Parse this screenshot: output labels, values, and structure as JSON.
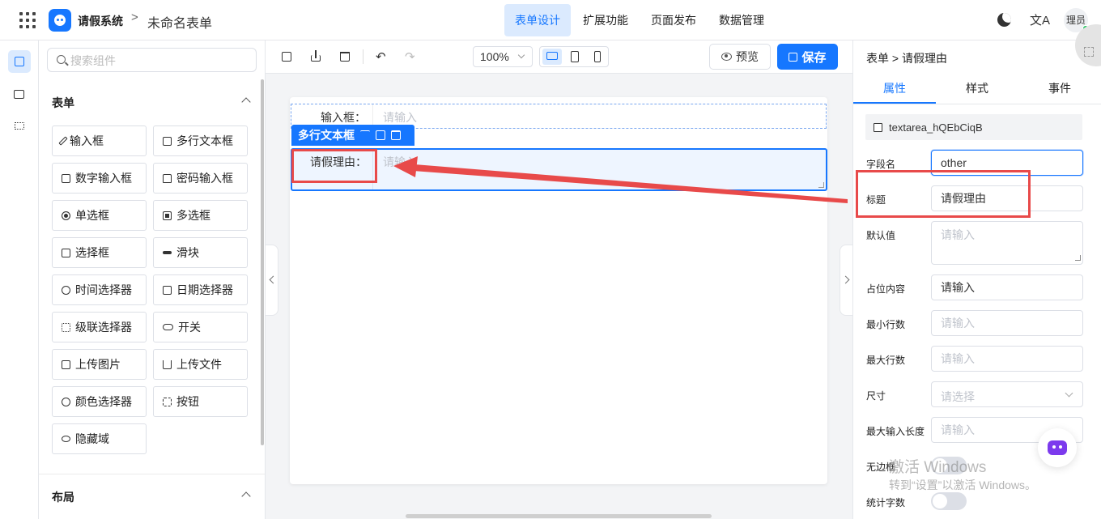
{
  "header": {
    "app_name": "请假系统",
    "separator": ">",
    "doc_name": "未命名表单",
    "tabs": [
      {
        "label": "表单设计",
        "active": true
      },
      {
        "label": "扩展功能",
        "active": false
      },
      {
        "label": "页面发布",
        "active": false
      },
      {
        "label": "数据管理",
        "active": false
      }
    ],
    "lang_glyph": "文A",
    "avatar_text": "理员",
    "accent_color": "#1677ff"
  },
  "rail": {
    "items": [
      {
        "icon": "puzzle-icon",
        "active": true
      },
      {
        "icon": "code-block-icon",
        "active": false
      },
      {
        "icon": "tree-icon",
        "active": false
      }
    ]
  },
  "components": {
    "search_placeholder": "搜索组件",
    "sections": [
      {
        "title": "表单",
        "items": [
          {
            "label": "输入框",
            "icon": "pen-icon"
          },
          {
            "label": "多行文本框",
            "icon": "textarea-icon"
          },
          {
            "label": "数字输入框",
            "icon": "number-icon"
          },
          {
            "label": "密码输入框",
            "icon": "lock-icon"
          },
          {
            "label": "单选框",
            "icon": "radio-icon"
          },
          {
            "label": "多选框",
            "icon": "checkbox-icon"
          },
          {
            "label": "选择框",
            "icon": "select-icon"
          },
          {
            "label": "滑块",
            "icon": "slider-icon"
          },
          {
            "label": "时间选择器",
            "icon": "clock-icon"
          },
          {
            "label": "日期选择器",
            "icon": "calendar-icon"
          },
          {
            "label": "级联选择器",
            "icon": "cascader-icon"
          },
          {
            "label": "开关",
            "icon": "switch-icon"
          },
          {
            "label": "上传图片",
            "icon": "image-icon"
          },
          {
            "label": "上传文件",
            "icon": "upload-icon"
          },
          {
            "label": "颜色选择器",
            "icon": "palette-icon"
          },
          {
            "label": "按钮",
            "icon": "button-icon"
          },
          {
            "label": "隐藏域",
            "icon": "eye-off-icon"
          }
        ]
      },
      {
        "title": "布局",
        "items": []
      }
    ]
  },
  "toolbar": {
    "zoom": "100%",
    "preview_label": "预览",
    "save_label": "保存",
    "device_active": "desktop"
  },
  "canvas": {
    "fields": [
      {
        "label": "输入框：",
        "placeholder": "请输入"
      },
      {
        "label": "请假理由：",
        "placeholder": "请输入"
      }
    ],
    "selected_tag": "多行文本框"
  },
  "properties": {
    "breadcrumb": "表单 > 请假理由",
    "tabs": [
      {
        "label": "属性",
        "active": true
      },
      {
        "label": "样式",
        "active": false
      },
      {
        "label": "事件",
        "active": false
      }
    ],
    "component_id": "textarea_hQEbCiqB",
    "rows": {
      "field_name": {
        "label": "字段名",
        "value": "other"
      },
      "title": {
        "label": "标题",
        "value": "请假理由"
      },
      "default": {
        "label": "默认值",
        "placeholder": "请输入"
      },
      "placeholder": {
        "label": "占位内容",
        "value": "请输入"
      },
      "min_rows": {
        "label": "最小行数",
        "placeholder": "请输入"
      },
      "max_rows": {
        "label": "最大行数",
        "placeholder": "请输入"
      },
      "size": {
        "label": "尺寸",
        "placeholder": "请选择"
      },
      "max_length": {
        "label": "最大输入长度",
        "placeholder": "请输入"
      },
      "borderless": {
        "label": "无边框",
        "on": false
      },
      "count": {
        "label": "统计字数",
        "on": false
      }
    }
  },
  "watermark": {
    "line1": "激活 Windows",
    "line2": "转到“设置”以激活 Windows。"
  },
  "annotation_color": "#e84a4a"
}
